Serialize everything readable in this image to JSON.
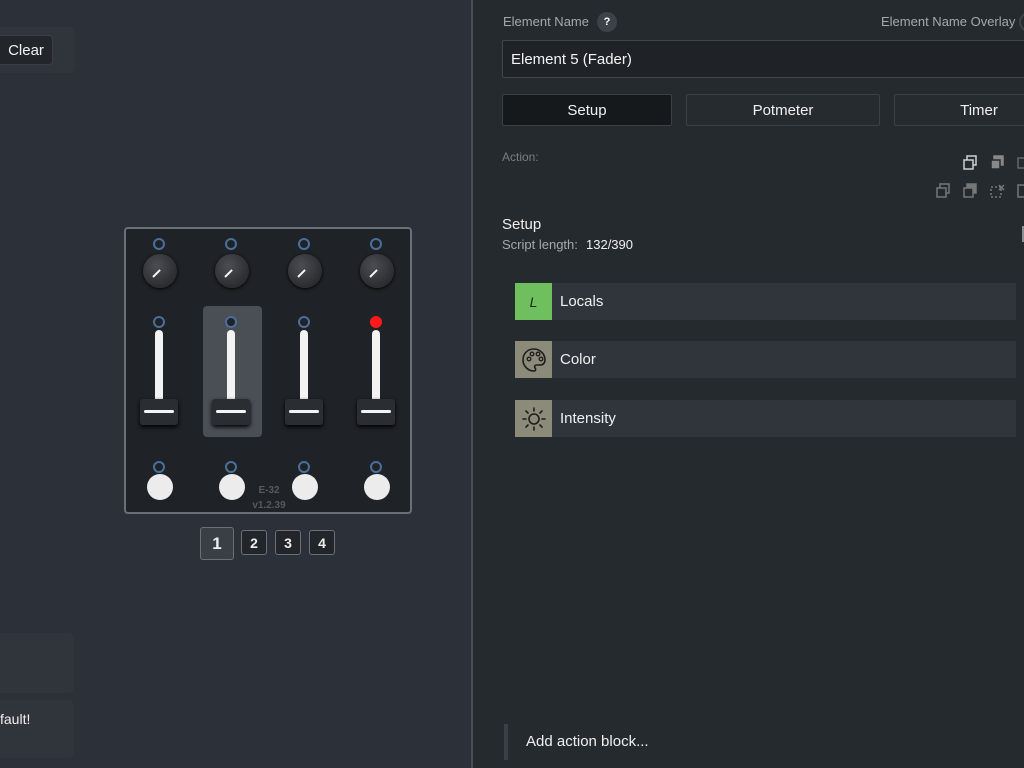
{
  "left": {
    "clear_label": "Clear",
    "toast2_text": "fault!"
  },
  "module": {
    "name": "E-32",
    "version": "v1.2.39",
    "leds_top": [
      "off",
      "off",
      "off",
      "off"
    ],
    "leds_mid": [
      "off",
      "off",
      "off",
      "on"
    ],
    "leds_bottom": [
      "off",
      "off",
      "off",
      "off"
    ],
    "selected_fader": 2
  },
  "pages": [
    "1",
    "2",
    "3",
    "4"
  ],
  "active_page": "1",
  "panel": {
    "element_name_label": "Element Name",
    "help_label": "?",
    "element_name_overlay_label": "Element Name Overlay",
    "element_name_value": "Element 5 (Fader)",
    "tabs": [
      {
        "label": "Setup",
        "active": true
      },
      {
        "label": "Potmeter",
        "active": false
      },
      {
        "label": "Timer",
        "active": false
      }
    ],
    "action_label": "Action:",
    "setup_title": "Setup",
    "script_length_label": "Script length:",
    "script_length_value": "132/390",
    "blocks": [
      {
        "label": "Locals",
        "icon": "locals-icon",
        "icon_text": "L",
        "color": "#6fbf5f"
      },
      {
        "label": "Color",
        "icon": "palette-icon",
        "color": "#8c8a78"
      },
      {
        "label": "Intensity",
        "icon": "sun-icon",
        "color": "#8c8a78"
      }
    ],
    "add_block_label": "Add action block..."
  }
}
